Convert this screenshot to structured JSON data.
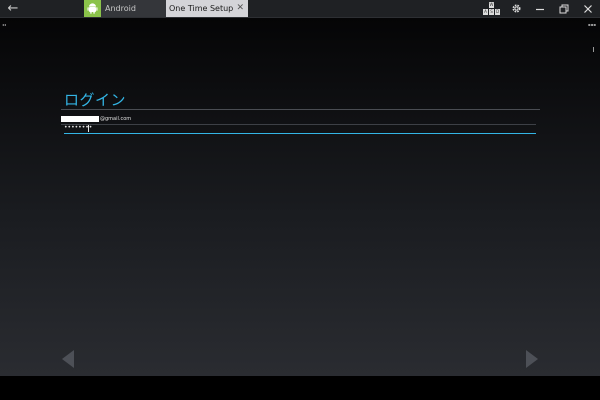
{
  "window": {
    "tabs": [
      {
        "label": "Android"
      },
      {
        "label": "One Time Setup"
      }
    ],
    "close_glyph": "✕"
  },
  "toolbar_icons": [
    "back-arrow-icon",
    "keyboard-icon",
    "gear-icon",
    "minimize-icon",
    "restore-icon",
    "close-icon"
  ],
  "keyboard_icon_keys": [
    "W",
    "A",
    "S",
    "D"
  ],
  "login": {
    "title": "ログイン",
    "email_domain": "@gmail.com",
    "password_mask": "••••••••"
  },
  "colors": {
    "accent": "#33b5e5",
    "android_green": "#8bc34a",
    "tab_active": "#d4d4d8"
  }
}
